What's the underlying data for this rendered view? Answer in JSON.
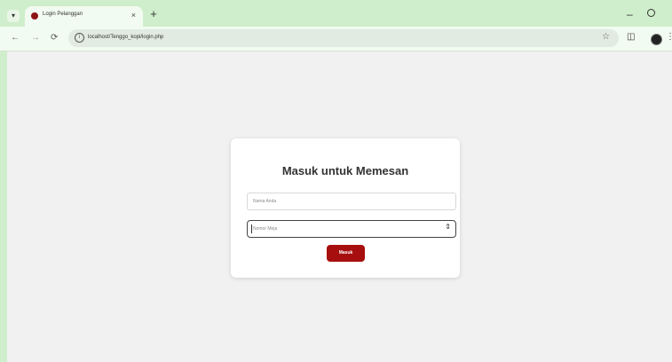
{
  "browser": {
    "tab_title": "Login Pelanggan",
    "tab_close": "×",
    "new_tab": "+",
    "tab_list_icon": "chevron-down-icon",
    "window": {
      "minimize": "–"
    },
    "url": "localhost/Tenggo_kopi/login.php",
    "nav": {
      "back": "←",
      "forward": "→",
      "reload": "⟳"
    },
    "info_icon": "i",
    "star": "☆",
    "extensions": "◫",
    "menu": "⋮"
  },
  "page": {
    "heading": "Masuk untuk Memesan",
    "name_placeholder": "Nama Anda",
    "table_placeholder": "Nomor Meja",
    "spinner": "⇕",
    "submit_label": "Masuk"
  },
  "colors": {
    "accent": "#a70f0f",
    "browser_frame": "#cfeecb",
    "page_background": "#f1f1f1"
  }
}
